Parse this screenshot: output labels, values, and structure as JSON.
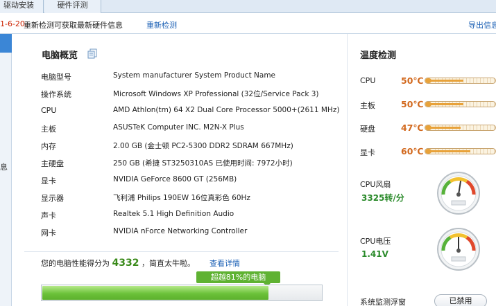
{
  "tabs": [
    "驱动安装",
    "硬件评测"
  ],
  "info_bar": {
    "date_fragment": "1-6-20,",
    "message": "重新检测可获取最新硬件信息",
    "recheck_link": "重新检测",
    "export_link": "导出信息"
  },
  "left_strip": {
    "char": "息"
  },
  "overview": {
    "title": "电脑概览",
    "rows": [
      {
        "label": "电脑型号",
        "value": "System manufacturer System Product Name"
      },
      {
        "label": "操作系统",
        "value": "Microsoft Windows XP Professional (32位/Service Pack 3)"
      },
      {
        "label": "CPU",
        "value": "AMD Athlon(tm) 64 X2 Dual Core Processor 5000+(2611 MHz)"
      },
      {
        "label": "主板",
        "value": "ASUSTeK Computer INC. M2N-X Plus"
      },
      {
        "label": "内存",
        "value": "2.00 GB (金士顿 PC2-5300 DDR2 SDRAM 667MHz)"
      },
      {
        "label": "主硬盘",
        "value": "250 GB (希捷 ST3250310AS 已使用时间: 7972小时)"
      },
      {
        "label": "显卡",
        "value": "NVIDIA GeForce 8600 GT (256MB)"
      },
      {
        "label": "显示器",
        "value": "飞利浦 Philips 190EW 16位真彩色 60Hz"
      },
      {
        "label": "声卡",
        "value": "Realtek 5.1 High Definition Audio"
      },
      {
        "label": "网卡",
        "value": "NVIDIA nForce Networking Controller"
      }
    ]
  },
  "score": {
    "prefix": "您的电脑性能得分为",
    "value": "4332",
    "suffix": "，简直太牛啦。",
    "detail_link": "查看详情",
    "badge": "超越81%的电脑",
    "percent": 81
  },
  "temperature": {
    "title": "温度检测",
    "items": [
      {
        "label": "CPU",
        "value": "50℃",
        "level": 0.5
      },
      {
        "label": "主板",
        "value": "50℃",
        "level": 0.5
      },
      {
        "label": "硬盘",
        "value": "47℃",
        "level": 0.47
      },
      {
        "label": "显卡",
        "value": "60℃",
        "level": 0.6
      }
    ]
  },
  "fan": {
    "label": "CPU风扇",
    "value": "3325转/分",
    "level": 0.55
  },
  "voltage": {
    "label": "CPU电压",
    "value": "1.41V",
    "level": 0.5
  },
  "monitor": {
    "label": "系统监测浮窗",
    "button": "已禁用"
  },
  "colors": {
    "accent_blue": "#1a5fb4",
    "temp_orange": "#d2691e",
    "score_green": "#3a8a1a",
    "bar_green": "#6cc23a"
  }
}
